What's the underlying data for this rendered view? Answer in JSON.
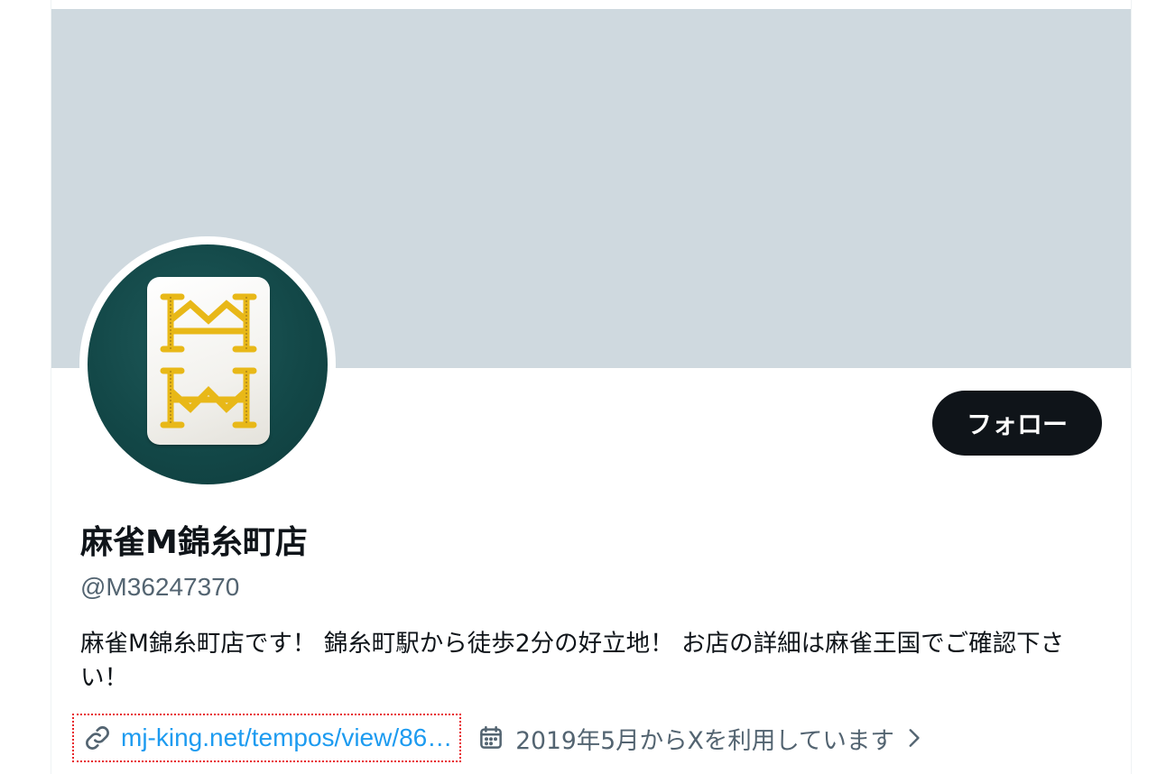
{
  "profile": {
    "display_name": "麻雀M錦糸町店",
    "handle": "@M36247370",
    "bio": "麻雀M錦糸町店です！ 錦糸町駅から徒歩2分の好立地！ お店の詳細は麻雀王国でご確認下さい！",
    "url": "mj-king.net/tempos/view/86…",
    "joined": "2019年5月からXを利用しています"
  },
  "actions": {
    "follow_label": "フォロー"
  },
  "icons": {
    "link": "link-icon",
    "calendar": "calendar-icon",
    "chevron": "chevron-right-icon"
  },
  "colors": {
    "banner": "#cfd9df",
    "link": "#1d9bf0",
    "secondary_text": "#536471",
    "follow_button": "#0f1419",
    "avatar_background": "#134848",
    "tile_engraving": "#e8b818"
  }
}
